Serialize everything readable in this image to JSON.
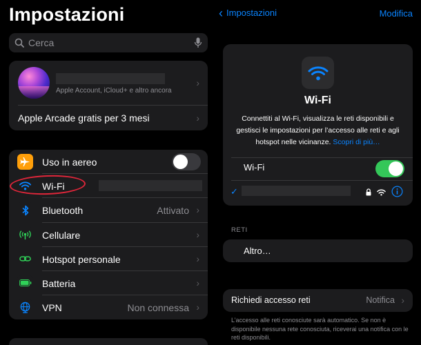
{
  "left": {
    "title": "Impostazioni",
    "search_placeholder": "Cerca",
    "account_subtitle": "Apple Account, iCloud+ e altro ancora",
    "arcade_label": "Apple Arcade gratis per 3 mesi",
    "rows": [
      {
        "label": "Uso in aereo",
        "value": "",
        "icon": "airplane-icon",
        "color": "#ff9f0a"
      },
      {
        "label": "Wi-Fi",
        "value": "",
        "icon": "wifi-icon",
        "color": "#0a84ff"
      },
      {
        "label": "Bluetooth",
        "value": "Attivato",
        "icon": "bluetooth-icon",
        "color": "#0a84ff"
      },
      {
        "label": "Cellulare",
        "value": "",
        "icon": "cellular-icon",
        "color": "#30d158"
      },
      {
        "label": "Hotspot personale",
        "value": "",
        "icon": "hotspot-icon",
        "color": "#30d158"
      },
      {
        "label": "Batteria",
        "value": "",
        "icon": "battery-icon",
        "color": "#30d158"
      },
      {
        "label": "VPN",
        "value": "Non connessa",
        "icon": "vpn-icon",
        "color": "#0a84ff"
      }
    ]
  },
  "right": {
    "back_label": "Impostazioni",
    "edit_label": "Modifica",
    "card_title": "Wi-Fi",
    "card_description": "Connettiti al Wi-Fi, visualizza le reti disponibili e gestisci le impostazioni per l’accesso alle reti e agli hotspot nelle vicinanze.",
    "card_link": "Scopri di più…",
    "wifi_toggle_label": "Wi-Fi",
    "networks_section": "RETI",
    "other_label": "Altro…",
    "ask_join_label": "Richiedi accesso reti",
    "ask_join_value": "Notifica",
    "footer_text": "L’accesso alle reti conosciute sarà automatico. Se non è disponibile nessuna rete conosciuta, riceverai una notifica con le reti disponibili."
  },
  "colors": {
    "accent": "#0a84ff",
    "toggle_on": "#34c759",
    "annotation": "#e0263a"
  }
}
